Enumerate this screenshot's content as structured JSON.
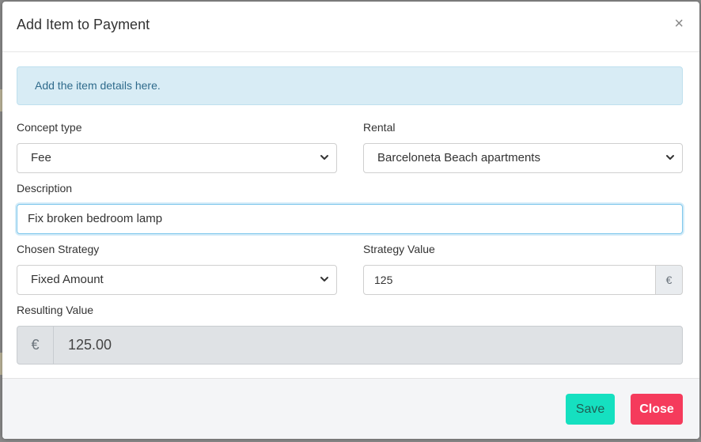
{
  "modal": {
    "title": "Add Item to Payment",
    "close_symbol": "×"
  },
  "alert": {
    "text": "Add the item details here."
  },
  "form": {
    "concept_type": {
      "label": "Concept type",
      "value": "Fee"
    },
    "rental": {
      "label": "Rental",
      "value": "Barceloneta Beach apartments"
    },
    "description": {
      "label": "Description",
      "value": "Fix broken bedroom lamp"
    },
    "chosen_strategy": {
      "label": "Chosen Strategy",
      "value": "Fixed Amount"
    },
    "strategy_value": {
      "label": "Strategy Value",
      "value": "125",
      "currency": "€"
    },
    "resulting_value": {
      "label": "Resulting Value",
      "value": "125.00",
      "currency": "€"
    }
  },
  "footer": {
    "save_label": "Save",
    "close_label": "Close"
  },
  "icons": {
    "select_arrow": "chevron-down-icon"
  }
}
